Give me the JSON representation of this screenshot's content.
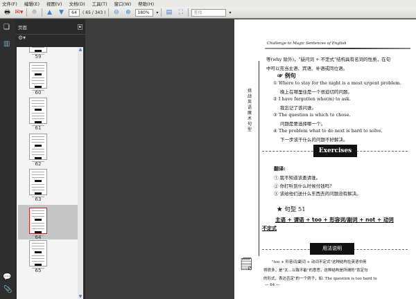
{
  "menu": [
    "文件(F)",
    "编辑(E)",
    "视图(V)",
    "文档(D)",
    "工具(T)",
    "窗口(W)",
    "帮助(H)"
  ],
  "toolbar": {
    "page_input": "64",
    "page_count": "( 65 / 343 )",
    "zoom": "180%",
    "search_placeholder": "查找"
  },
  "panel": {
    "title": "页面"
  },
  "thumbnails": [
    {
      "label": "59"
    },
    {
      "label": "60"
    },
    {
      "label": "61"
    },
    {
      "label": "62"
    },
    {
      "label": "63"
    },
    {
      "label": "64",
      "selected": true
    },
    {
      "label": "65"
    }
  ],
  "document": {
    "header": "Challenge to Magic Sentences of English",
    "side_text": "挑战英语魔术句型",
    "para": [
      "等(why 除外)，\"疑问词 + 不定式\"结构具有名词的性质，在句",
      "中可以充当主语、宾语、补语或同位语。"
    ],
    "example_title": "☞ 例句",
    "examples": [
      {
        "en": "① Where to stay for the night is a most urgent problem.",
        "zh": "晚上在哪里住是一个很迫切的问题。"
      },
      {
        "en": "② I have forgotten who(m) to ask.",
        "zh": "我忘记了该问谁。"
      },
      {
        "en": "③ The question is which to chose.",
        "zh": "问题是要选择哪一个。"
      },
      {
        "en": "④ The problem what to do next is hard to solve.",
        "zh": "下一步该干什么的问题不好解决。"
      }
    ],
    "exercises_label": "Exercises",
    "translate_title": "翻译:",
    "translate": [
      "① 我不知道该邀请谁。",
      "② 你打听到什么时候付钱吗?",
      "③ 该给他们送什么东西去的问题没有解决。"
    ],
    "pattern_title": "★ 句型 51",
    "pattern": "主语 + 谓语 + too  + 形容词/副词 + not  + 动词",
    "pattern2": "不定式",
    "usage_label": "用法说明",
    "usage": [
      "\"too + 形容词/副词 + 动词不定式\"这种结构在英语中用",
      "得很多，是\"太…以致不能\"的意思，这种结构是所谓的\"肯定句",
      "的形式，表达否定\"的一个例子，如: The question is too hard to"
    ],
    "page_number": "— 64 —"
  }
}
